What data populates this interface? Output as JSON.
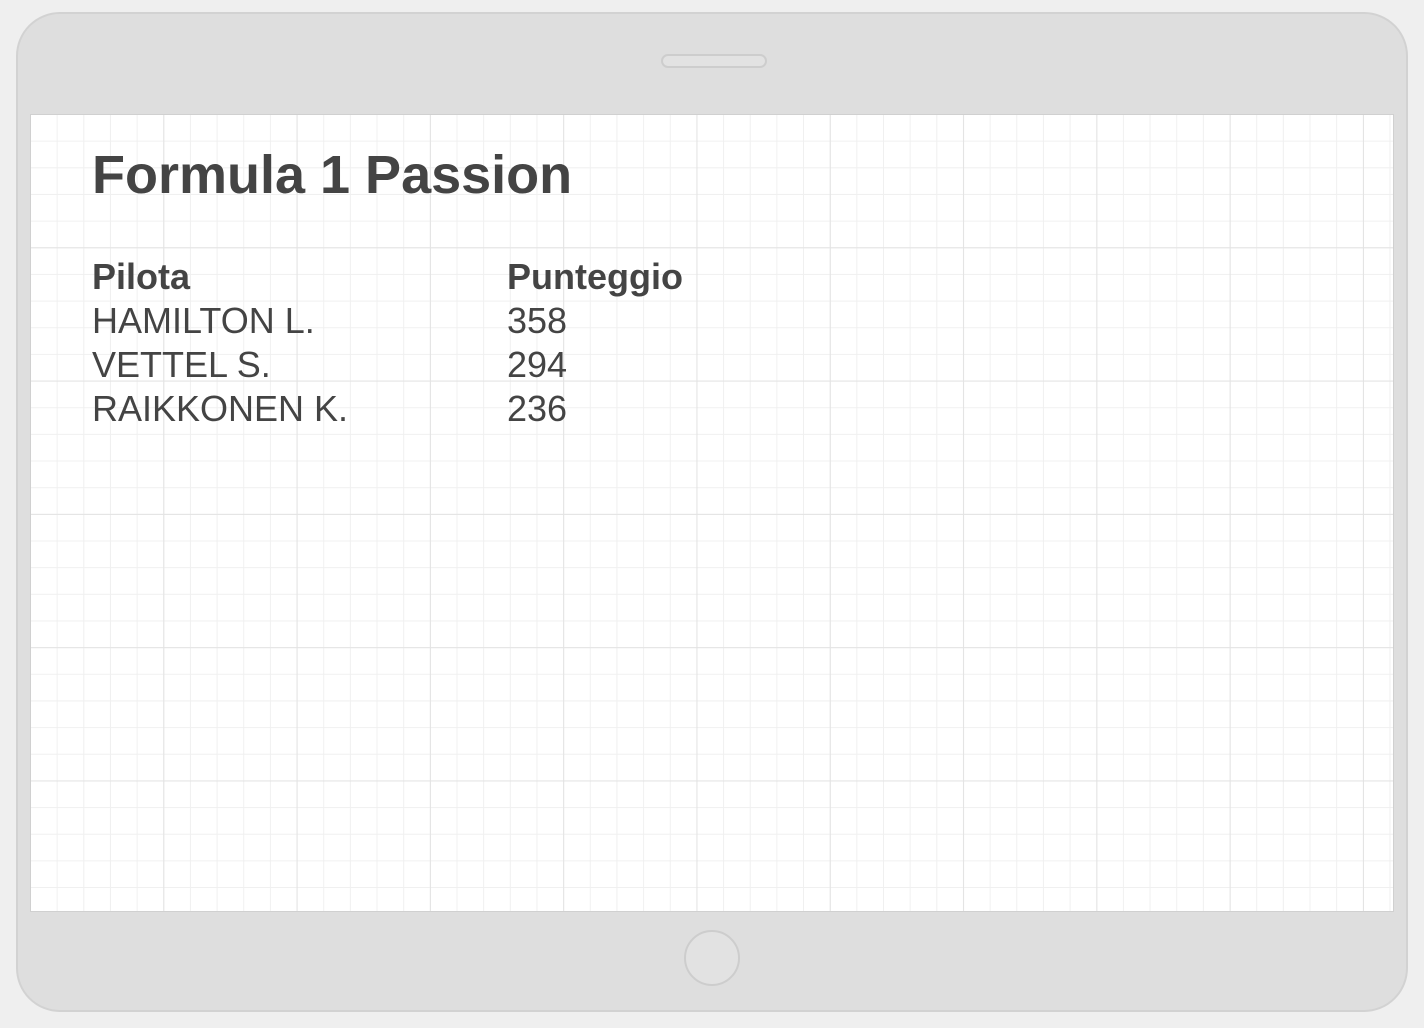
{
  "app": {
    "title": "Formula 1 Passion"
  },
  "table": {
    "headers": {
      "pilot": "Pilota",
      "score": "Punteggio"
    },
    "rows": [
      {
        "pilot": "HAMILTON L.",
        "score": "358"
      },
      {
        "pilot": "VETTEL S.",
        "score": "294"
      },
      {
        "pilot": "RAIKKONEN K.",
        "score": "236"
      }
    ]
  },
  "colors": {
    "text": "#444444",
    "device_frame": "#dedede",
    "screen_background": "#ffffff",
    "grid_line": "#e3e3e3"
  }
}
